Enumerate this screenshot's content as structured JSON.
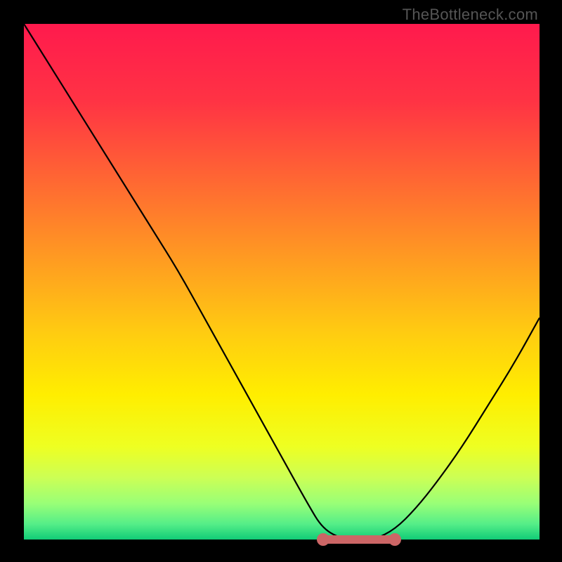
{
  "watermark": "TheBottleneck.com",
  "chart_data": {
    "type": "line",
    "title": "",
    "xlabel": "",
    "ylabel": "",
    "xlim": [
      0,
      100
    ],
    "ylim": [
      0,
      100
    ],
    "series": [
      {
        "name": "curve",
        "x": [
          0,
          5,
          10,
          15,
          20,
          25,
          30,
          35,
          40,
          45,
          50,
          55,
          58,
          62,
          65,
          68,
          72,
          76,
          80,
          85,
          90,
          95,
          100
        ],
        "y": [
          100,
          92,
          84,
          76,
          68,
          60,
          52,
          43,
          34,
          25,
          16,
          7,
          2,
          0,
          0,
          0,
          2,
          6,
          11,
          18,
          26,
          34,
          43
        ]
      }
    ],
    "flat_region": {
      "x_start": 58,
      "x_end": 72,
      "y": 0
    },
    "markers": [
      {
        "x": 58,
        "y": 0
      },
      {
        "x": 72,
        "y": 0
      }
    ],
    "gradient_stops": [
      {
        "pos": 0,
        "color": "#ff1a4d"
      },
      {
        "pos": 15,
        "color": "#ff3344"
      },
      {
        "pos": 30,
        "color": "#ff6633"
      },
      {
        "pos": 45,
        "color": "#ff9922"
      },
      {
        "pos": 60,
        "color": "#ffcc11"
      },
      {
        "pos": 72,
        "color": "#ffee00"
      },
      {
        "pos": 82,
        "color": "#eeff22"
      },
      {
        "pos": 88,
        "color": "#ccff55"
      },
      {
        "pos": 93,
        "color": "#99ff77"
      },
      {
        "pos": 97,
        "color": "#55ee88"
      },
      {
        "pos": 100,
        "color": "#11cc77"
      }
    ]
  }
}
